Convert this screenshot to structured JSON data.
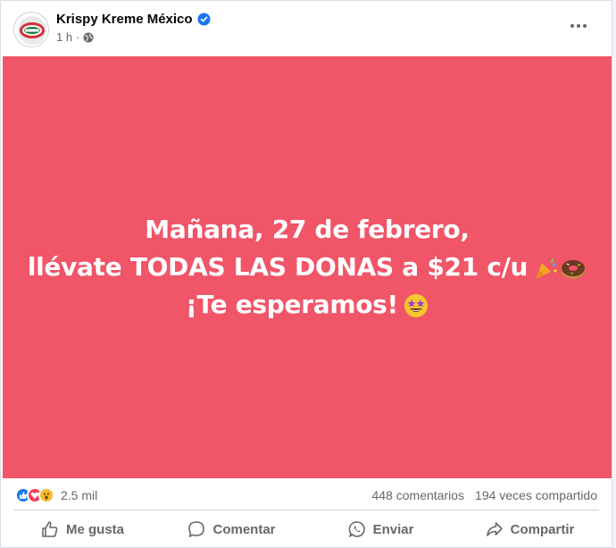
{
  "post": {
    "author": "Krispy Kreme México",
    "time": "1 h",
    "meta_separator": "·",
    "background_color": "#f05568",
    "text_lines": [
      "Mañana, 27 de febrero,",
      "llévate TODAS LAS DONAS a $21 c/u",
      "¡Te esperamos!"
    ]
  },
  "stats": {
    "reactions_count": "2.5 mil",
    "comments": "448 comentarios",
    "shares": "194 veces compartido"
  },
  "actions": {
    "like": "Me gusta",
    "comment": "Comentar",
    "send": "Enviar",
    "share": "Compartir"
  },
  "icons": {
    "verified": "verified-badge-icon",
    "privacy": "globe-icon",
    "more": "more-options-icon",
    "reactions": [
      "like-reaction-icon",
      "love-reaction-icon",
      "wow-reaction-icon"
    ],
    "post_emojis": [
      "party-popper-emoji",
      "donut-emoji",
      "star-struck-emoji"
    ]
  },
  "colors": {
    "brand_blue": "#1877f2",
    "love_red": "#f33e58",
    "wow_yellow": "#f7b928"
  }
}
